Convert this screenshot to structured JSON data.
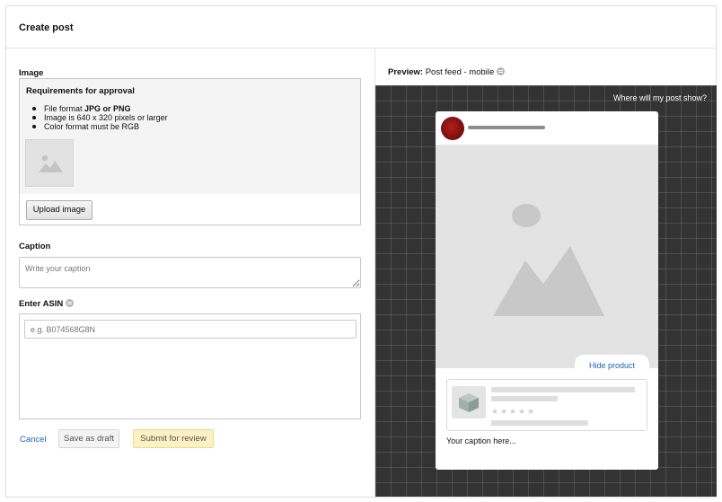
{
  "header": {
    "title": "Create post"
  },
  "image_section": {
    "label": "Image",
    "requirements_title": "Requirements for approval",
    "requirements": [
      {
        "prefix": "File format ",
        "bold": "JPG or PNG",
        "suffix": ""
      },
      {
        "prefix": "Image is 640 x 320 pixels or larger",
        "bold": "",
        "suffix": ""
      },
      {
        "prefix": "Color format must be RGB",
        "bold": "",
        "suffix": ""
      }
    ],
    "upload_button": "Upload image"
  },
  "caption_section": {
    "label": "Caption",
    "placeholder": "Write your caption"
  },
  "asin_section": {
    "label": "Enter ASIN",
    "placeholder": "e.g. B074568G8N"
  },
  "actions": {
    "cancel": "Cancel",
    "save_draft": "Save as draft",
    "submit": "Submit for review"
  },
  "preview": {
    "label_bold": "Preview:",
    "label_rest": " Post feed - mobile",
    "where_link": "Where will my post show?",
    "hide_product": "Hide product",
    "caption_placeholder": "Your caption here...",
    "product_rating_stars": 5
  },
  "colors": {
    "link_blue": "#1a64b8",
    "submit_bg": "#fdf0c2",
    "canvas_bg": "#333333"
  }
}
